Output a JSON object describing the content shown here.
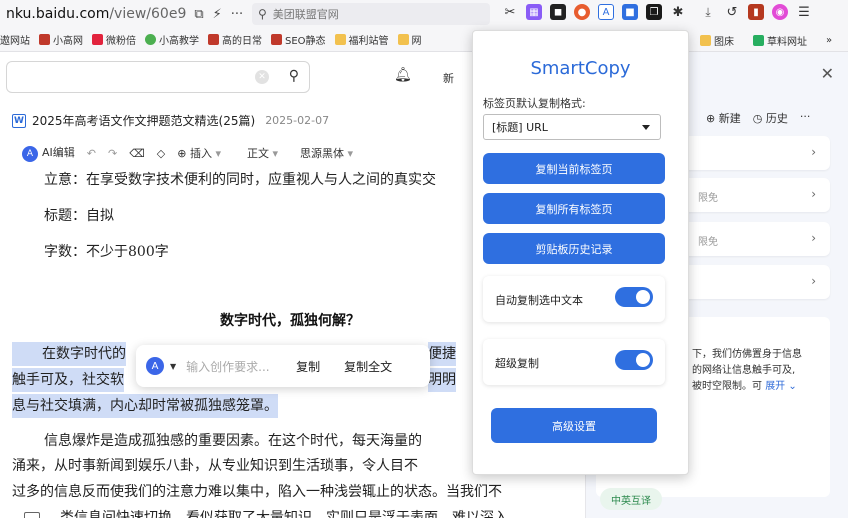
{
  "browser": {
    "url_prefix": "nku.baidu.com",
    "url_path": "/view/60e9",
    "search_placeholder": "美团联盟官网",
    "bookmarks": [
      "遨网站",
      "小高网",
      "微粉倍",
      "小高教学",
      "高的日常",
      "SEO静态",
      "福利站管",
      "网"
    ],
    "bookmarks_right": [
      "图床",
      "草料网址"
    ],
    "more_label": "»"
  },
  "doc": {
    "title": "2025年高考语文作文押题范文精选(25篇)",
    "date": "2025-02-07",
    "new_label": "新",
    "toolbar": {
      "ai_edit": "AI编辑",
      "insert": "插入",
      "style": "正文",
      "font": "思源黑体"
    },
    "lines": {
      "intent": "立意：在享受数字技术便利的同时，应重视人与人之间的真实交",
      "topic": "标题：自拟",
      "words": "字数：不少于800字"
    },
    "heading": "数字时代，孤独何解？",
    "para1": {
      "start": "在数字时代的",
      "end": "便捷",
      "line2_start": "触手可及，社交软",
      "line2_end": "明明",
      "line3": "息与社交填满，内心却时常被孤独感笼罩。"
    },
    "para2": {
      "line1": "信息爆炸是造成孤独感的重要因素。在这个时代，每天海量的",
      "line2": "涌来，从时事新闻到娱乐八卦，从专业知识到生活琐事，令人目不",
      "line3": "过多的信息反而使我们的注意力难以集中，陷入一种浅尝辄止的状态。当我们不",
      "line4": "类信息间快速切换，看似获取了大量知识，实则只是浮于表面，难以深入"
    }
  },
  "floatbar": {
    "input_placeholder": "输入创作要求...",
    "copy": "复制",
    "copy_all": "复制全文"
  },
  "side_panel": {
    "new_label": "新建",
    "history_label": "历史",
    "more_label": "···",
    "card_tags": [
      "限免",
      "限免"
    ],
    "text_lines": [
      "下，我们仿佛置身于信息",
      "的网络让信息触手可及,",
      "被时空限制。可"
    ],
    "expand_label": "展开",
    "pill": "中英互译"
  },
  "popup": {
    "title": "SmartCopy",
    "format_label": "标签页默认复制格式:",
    "format_value": "[标题] URL",
    "btn_copy_current": "复制当前标签页",
    "btn_copy_all": "复制所有标签页",
    "btn_clipboard_history": "剪贴板历史记录",
    "toggle_auto_copy": "自动复制选中文本",
    "toggle_super_copy": "超级复制",
    "advanced_settings": "高级设置"
  }
}
